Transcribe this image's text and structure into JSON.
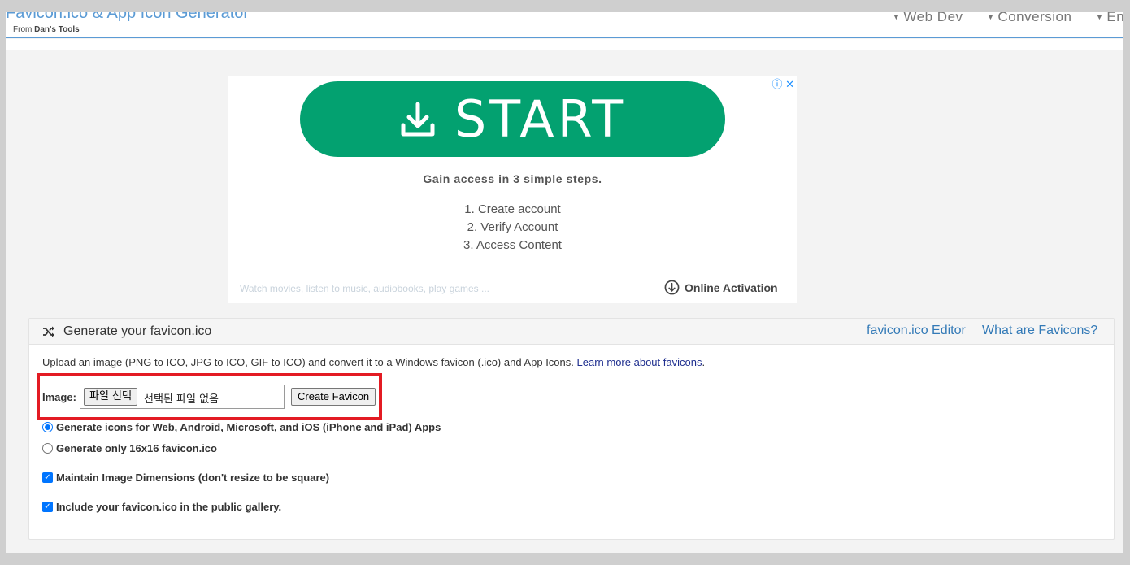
{
  "header": {
    "title": "Favicon.ico & App Icon Generator",
    "subtitle_prefix": "From",
    "subtitle_brand": "Dan's Tools",
    "nav": [
      "Web Dev",
      "Conversion",
      "En"
    ]
  },
  "ad": {
    "controls": "ⓘ ✕",
    "cta": "START",
    "steps_title": "Gain access in 3 simple steps.",
    "steps": [
      "1. Create account",
      "2. Verify Account",
      "3. Access Content"
    ],
    "footer_text": "Watch movies, listen to music, audiobooks, play games ...",
    "brand": "Online Activation",
    "cta_color": "#03a170"
  },
  "panel": {
    "title": "Generate your favicon.ico",
    "links": [
      "favicon.ico Editor",
      "What are Favicons?"
    ],
    "intro": "Upload an image (PNG to ICO, JPG to ICO, GIF to ICO) and convert it to a Windows favicon (.ico) and App Icons.",
    "intro_link": "Learn more about favicons",
    "intro_end": ".",
    "image_label": "Image:",
    "file_button": "파일 선택",
    "file_status": "선택된 파일 없음",
    "create_button": "Create Favicon",
    "options": [
      {
        "type": "radio",
        "checked": true,
        "label": "Generate icons for Web, Android, Microsoft, and iOS (iPhone and iPad) Apps"
      },
      {
        "type": "radio",
        "checked": false,
        "label": "Generate only 16x16 favicon.ico"
      },
      {
        "type": "checkbox",
        "checked": true,
        "label": "Maintain Image Dimensions (don't resize to be square)"
      },
      {
        "type": "checkbox",
        "checked": true,
        "label": "Include your favicon.ico in the public gallery."
      }
    ],
    "highlight_color": "#e31b23"
  }
}
